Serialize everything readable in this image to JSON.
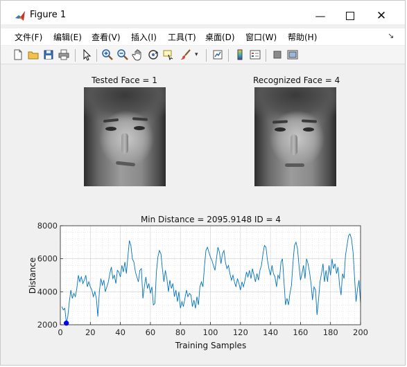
{
  "window": {
    "title": "Figure 1"
  },
  "menu": [
    {
      "label": "文件(F)"
    },
    {
      "label": "编辑(E)"
    },
    {
      "label": "查看(V)"
    },
    {
      "label": "插入(I)"
    },
    {
      "label": "工具(T)"
    },
    {
      "label": "桌面(D)"
    },
    {
      "label": "窗口(W)"
    },
    {
      "label": "帮助(H)"
    }
  ],
  "toolbar": {
    "icons": [
      "new-figure-icon",
      "open-file-icon",
      "save-icon",
      "print-icon",
      "select-arrow-icon",
      "zoom-in-icon",
      "zoom-out-icon",
      "pan-hand-icon",
      "rotate-3d-icon",
      "data-cursor-icon",
      "brush-icon",
      "link-plot-icon",
      "colorbar-icon",
      "legend-icon",
      "hide-plot-tools-icon",
      "show-plot-tools-icon"
    ]
  },
  "panels": {
    "tested": {
      "title": "Tested Face = 1"
    },
    "recognized": {
      "title": "Recognized Face = 4"
    }
  },
  "chart_data": {
    "type": "line",
    "title": "Min Distance = 2095.9148 ID = 4",
    "xlabel": "Training Samples",
    "ylabel": "Distance",
    "xlim": [
      0,
      200
    ],
    "ylim": [
      2000,
      8000
    ],
    "xticks": [
      0,
      20,
      40,
      60,
      80,
      100,
      120,
      140,
      160,
      180,
      200
    ],
    "yticks": [
      2000,
      4000,
      6000,
      8000
    ],
    "grid": "minor",
    "line_color": "#0072bd",
    "marker": {
      "x": 4,
      "y": 2095.9148,
      "color": "#0000ff"
    },
    "series": [
      {
        "values": [
          [
            1,
            3100
          ],
          [
            2,
            2900
          ],
          [
            3,
            3000
          ],
          [
            4,
            2096
          ],
          [
            5,
            2500
          ],
          [
            6,
            3400
          ],
          [
            7,
            4100
          ],
          [
            8,
            3600
          ],
          [
            9,
            3900
          ],
          [
            10,
            3700
          ],
          [
            11,
            4200
          ],
          [
            12,
            5000
          ],
          [
            13,
            4600
          ],
          [
            14,
            4900
          ],
          [
            15,
            4500
          ],
          [
            16,
            4700
          ],
          [
            17,
            5000
          ],
          [
            18,
            4300
          ],
          [
            19,
            4600
          ],
          [
            20,
            4300
          ],
          [
            21,
            4100
          ],
          [
            22,
            3700
          ],
          [
            23,
            4000
          ],
          [
            24,
            3600
          ],
          [
            25,
            2500
          ],
          [
            26,
            4000
          ],
          [
            27,
            4800
          ],
          [
            28,
            4400
          ],
          [
            29,
            4700
          ],
          [
            30,
            4000
          ],
          [
            31,
            4300
          ],
          [
            32,
            4600
          ],
          [
            33,
            5100
          ],
          [
            34,
            5500
          ],
          [
            35,
            4800
          ],
          [
            36,
            5000
          ],
          [
            37,
            4500
          ],
          [
            38,
            5300
          ],
          [
            39,
            5200
          ],
          [
            40,
            4900
          ],
          [
            41,
            5600
          ],
          [
            42,
            5200
          ],
          [
            43,
            5800
          ],
          [
            44,
            5100
          ],
          [
            45,
            6100
          ],
          [
            46,
            7100
          ],
          [
            47,
            6800
          ],
          [
            48,
            6000
          ],
          [
            49,
            5800
          ],
          [
            50,
            5200
          ],
          [
            51,
            4900
          ],
          [
            52,
            4600
          ],
          [
            53,
            5300
          ],
          [
            54,
            5400
          ],
          [
            55,
            3600
          ],
          [
            56,
            4300
          ],
          [
            57,
            4900
          ],
          [
            58,
            4200
          ],
          [
            59,
            4500
          ],
          [
            60,
            3900
          ],
          [
            61,
            4300
          ],
          [
            62,
            3200
          ],
          [
            63,
            3300
          ],
          [
            64,
            5200
          ],
          [
            65,
            6100
          ],
          [
            66,
            6500
          ],
          [
            67,
            6300
          ],
          [
            68,
            5400
          ],
          [
            69,
            4600
          ],
          [
            70,
            5300
          ],
          [
            71,
            4800
          ],
          [
            72,
            4000
          ],
          [
            73,
            4700
          ],
          [
            74,
            4200
          ],
          [
            75,
            4500
          ],
          [
            76,
            3700
          ],
          [
            77,
            4100
          ],
          [
            78,
            3400
          ],
          [
            79,
            4000
          ],
          [
            80,
            3000
          ],
          [
            81,
            3400
          ],
          [
            82,
            3100
          ],
          [
            83,
            3600
          ],
          [
            84,
            4100
          ],
          [
            85,
            3700
          ],
          [
            86,
            3900
          ],
          [
            87,
            3800
          ],
          [
            88,
            3100
          ],
          [
            89,
            3500
          ],
          [
            90,
            3000
          ],
          [
            91,
            3700
          ],
          [
            92,
            3200
          ],
          [
            93,
            4300
          ],
          [
            94,
            4600
          ],
          [
            95,
            4300
          ],
          [
            96,
            5500
          ],
          [
            97,
            6500
          ],
          [
            98,
            6700
          ],
          [
            99,
            6400
          ],
          [
            100,
            6100
          ],
          [
            101,
            5900
          ],
          [
            102,
            5600
          ],
          [
            103,
            5300
          ],
          [
            104,
            6000
          ],
          [
            105,
            6700
          ],
          [
            106,
            6400
          ],
          [
            107,
            5700
          ],
          [
            108,
            6300
          ],
          [
            109,
            6500
          ],
          [
            110,
            5800
          ],
          [
            111,
            5400
          ],
          [
            112,
            5600
          ],
          [
            113,
            5100
          ],
          [
            114,
            4700
          ],
          [
            115,
            5000
          ],
          [
            116,
            4600
          ],
          [
            117,
            4300
          ],
          [
            118,
            4800
          ],
          [
            119,
            4500
          ],
          [
            120,
            4100
          ],
          [
            121,
            4600
          ],
          [
            122,
            4300
          ],
          [
            123,
            4700
          ],
          [
            124,
            5200
          ],
          [
            125,
            4900
          ],
          [
            126,
            5300
          ],
          [
            127,
            4800
          ],
          [
            128,
            5400
          ],
          [
            129,
            5000
          ],
          [
            130,
            4600
          ],
          [
            131,
            5100
          ],
          [
            132,
            4700
          ],
          [
            133,
            5300
          ],
          [
            134,
            5600
          ],
          [
            135,
            6300
          ],
          [
            136,
            6800
          ],
          [
            137,
            6700
          ],
          [
            138,
            5900
          ],
          [
            139,
            5400
          ],
          [
            140,
            5000
          ],
          [
            141,
            5600
          ],
          [
            142,
            5100
          ],
          [
            143,
            4900
          ],
          [
            144,
            4300
          ],
          [
            145,
            5000
          ],
          [
            146,
            4800
          ],
          [
            147,
            5800
          ],
          [
            148,
            6000
          ],
          [
            149,
            4600
          ],
          [
            150,
            3200
          ],
          [
            151,
            3600
          ],
          [
            152,
            3200
          ],
          [
            153,
            3900
          ],
          [
            154,
            4400
          ],
          [
            155,
            5800
          ],
          [
            156,
            6800
          ],
          [
            157,
            7000
          ],
          [
            158,
            6600
          ],
          [
            159,
            5600
          ],
          [
            160,
            4700
          ],
          [
            161,
            5100
          ],
          [
            162,
            5600
          ],
          [
            163,
            4800
          ],
          [
            164,
            6000
          ],
          [
            165,
            5700
          ],
          [
            166,
            5200
          ],
          [
            167,
            4500
          ],
          [
            168,
            3500
          ],
          [
            169,
            4300
          ],
          [
            170,
            4100
          ],
          [
            171,
            2600
          ],
          [
            172,
            3500
          ],
          [
            173,
            4600
          ],
          [
            174,
            5100
          ],
          [
            175,
            5700
          ],
          [
            176,
            4600
          ],
          [
            177,
            5300
          ],
          [
            178,
            4600
          ],
          [
            179,
            5600
          ],
          [
            180,
            5000
          ],
          [
            181,
            6000
          ],
          [
            182,
            5400
          ],
          [
            183,
            5700
          ],
          [
            184,
            5100
          ],
          [
            185,
            5500
          ],
          [
            186,
            4400
          ],
          [
            187,
            3800
          ],
          [
            188,
            5100
          ],
          [
            189,
            4800
          ],
          [
            190,
            6200
          ],
          [
            191,
            6800
          ],
          [
            192,
            7400
          ],
          [
            193,
            7500
          ],
          [
            194,
            7200
          ],
          [
            195,
            6400
          ],
          [
            196,
            4900
          ],
          [
            197,
            3400
          ],
          [
            198,
            4200
          ],
          [
            199,
            4700
          ],
          [
            200,
            3300
          ]
        ]
      }
    ]
  }
}
